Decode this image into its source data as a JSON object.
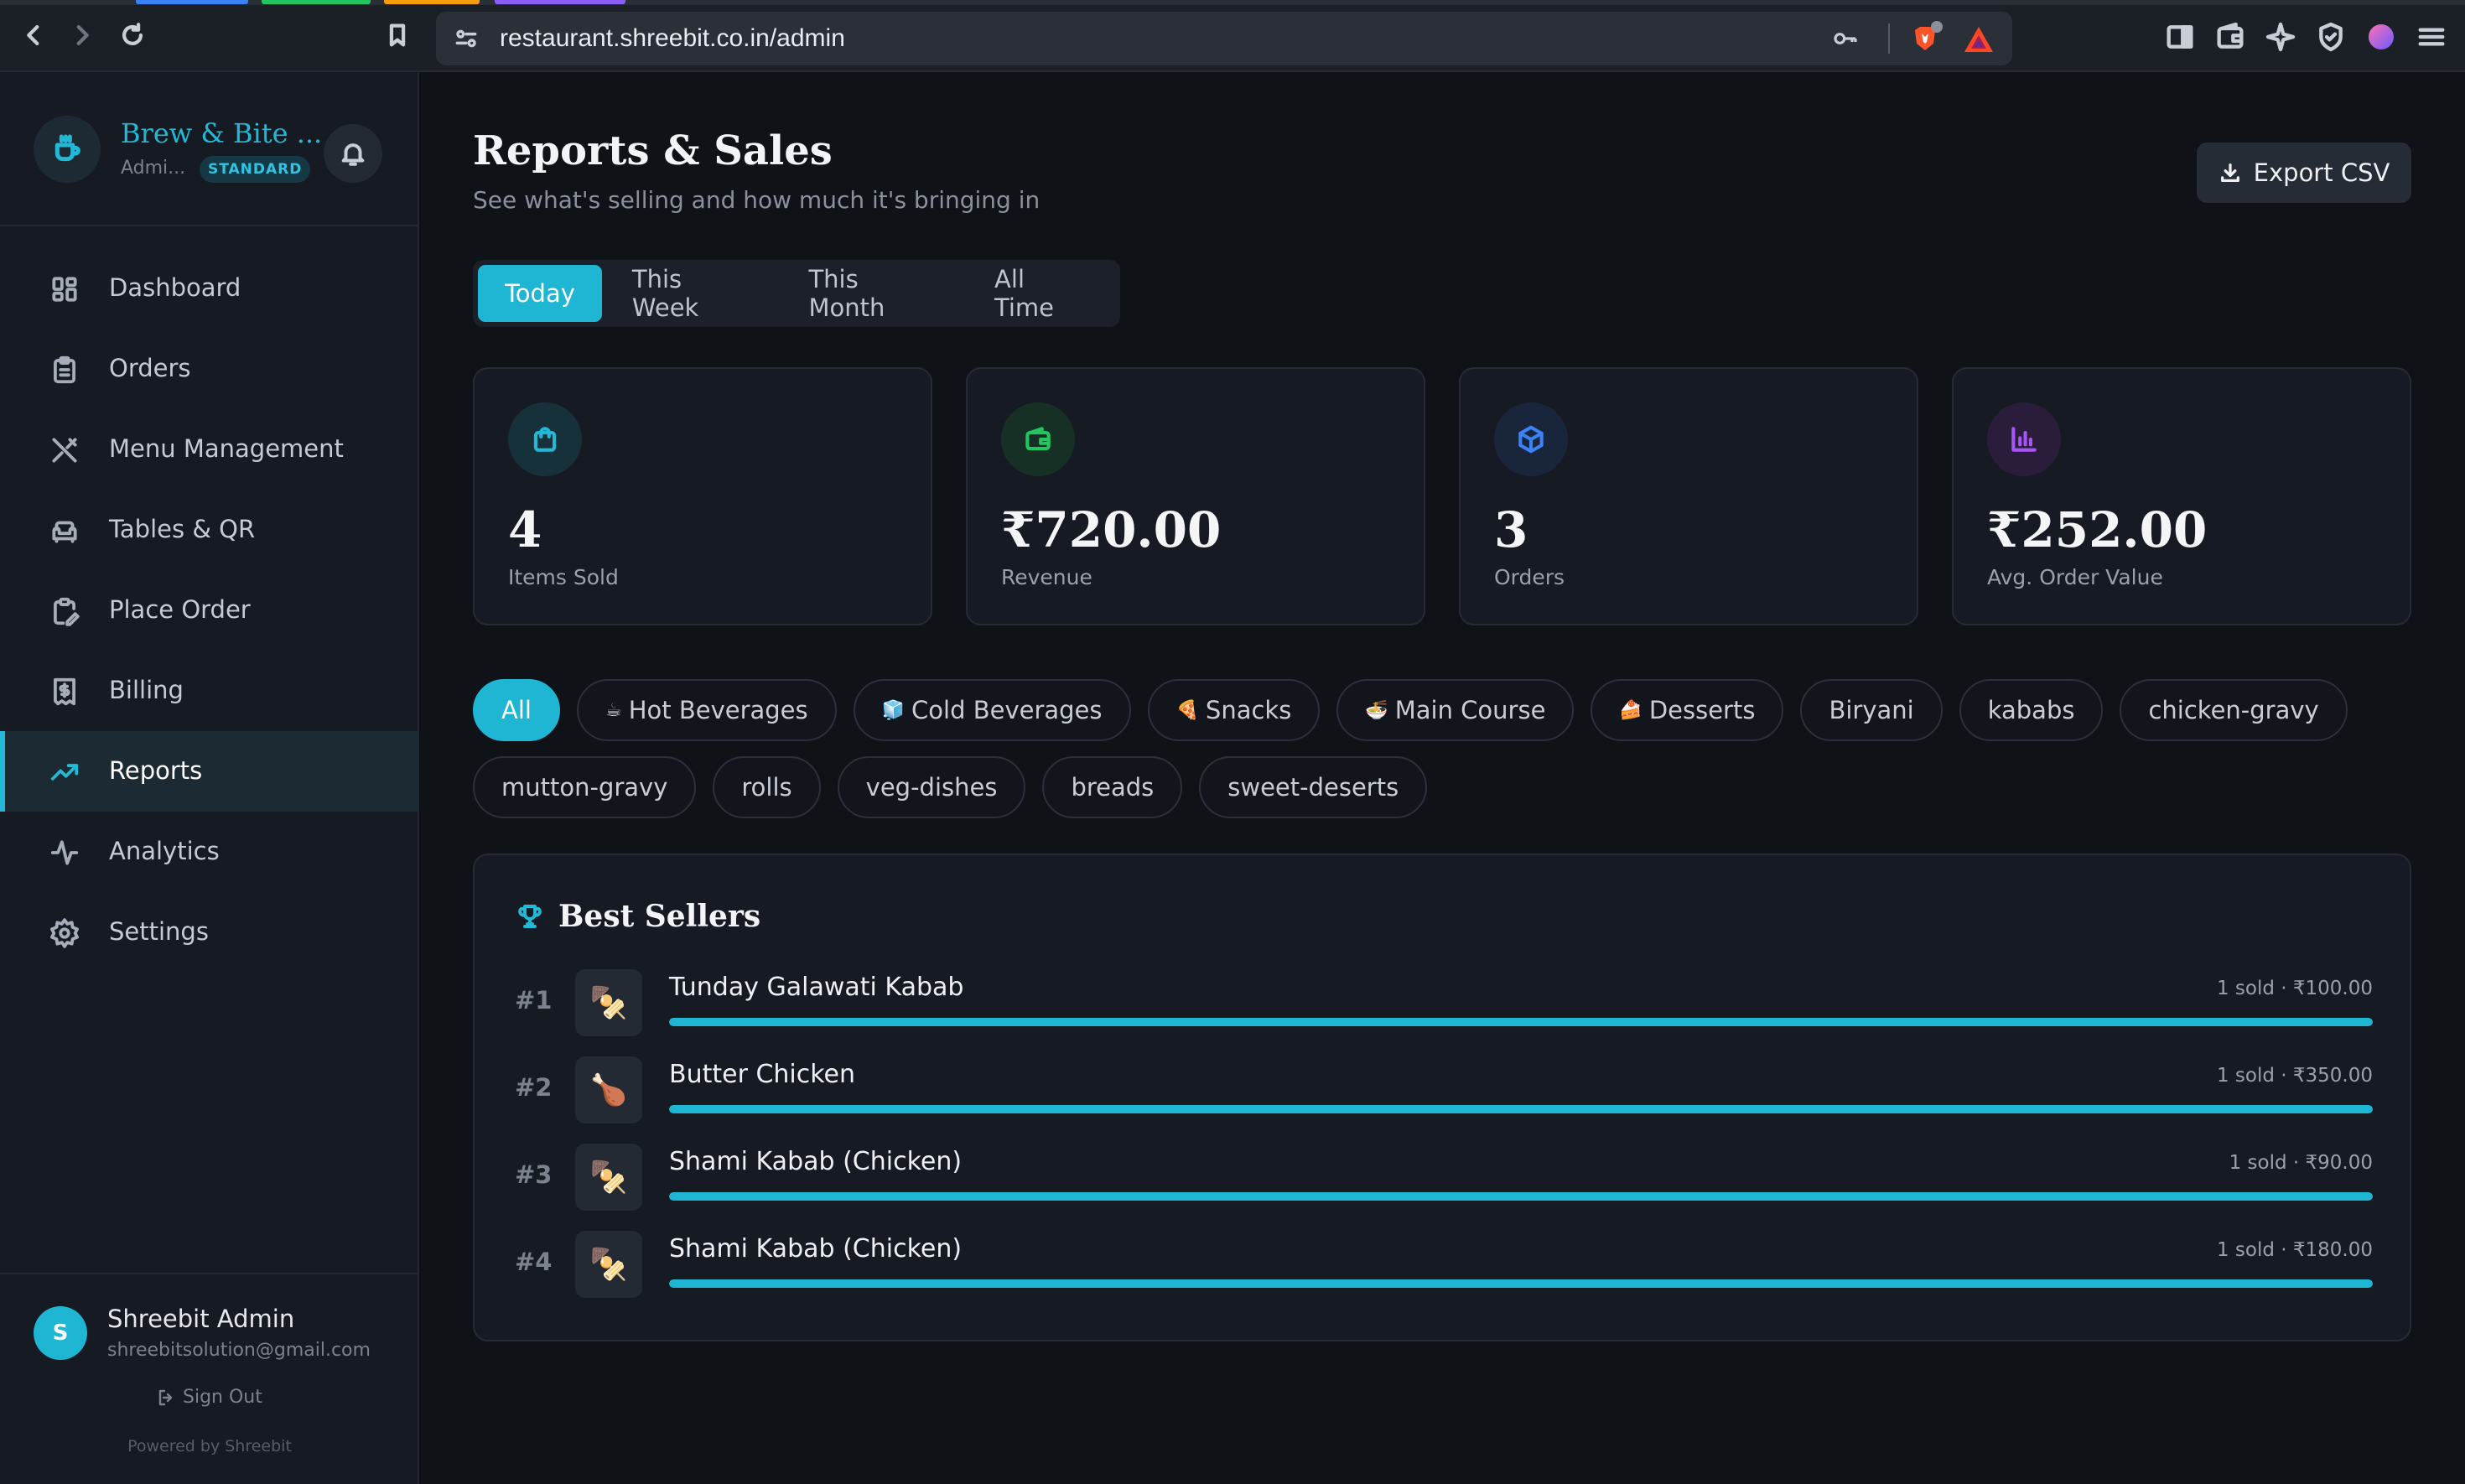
{
  "browser": {
    "url": "restaurant.shreebit.co.in/admin",
    "brave_badge": "1"
  },
  "sidebar": {
    "brand_name": "Brew & Bite ...",
    "role": "Admi...",
    "plan": "STANDARD",
    "items": [
      {
        "label": "Dashboard",
        "icon": "grid-icon"
      },
      {
        "label": "Orders",
        "icon": "clipboard-icon"
      },
      {
        "label": "Menu Management",
        "icon": "utensils-icon"
      },
      {
        "label": "Tables & QR",
        "icon": "sofa-icon"
      },
      {
        "label": "Place Order",
        "icon": "clipboard-pen-icon"
      },
      {
        "label": "Billing",
        "icon": "receipt-icon"
      },
      {
        "label": "Reports",
        "icon": "trending-up-icon",
        "active": true
      },
      {
        "label": "Analytics",
        "icon": "activity-icon"
      },
      {
        "label": "Settings",
        "icon": "gear-icon"
      }
    ],
    "user": {
      "initial": "S",
      "name": "Shreebit Admin",
      "email": "shreebitsolution@gmail.com",
      "sign_out": "Sign Out",
      "powered": "Powered by Shreebit"
    }
  },
  "main": {
    "title": "Reports & Sales",
    "subtitle": "See what's selling and how much it's bringing in",
    "export_label": "Export CSV",
    "periods": [
      "Today",
      "This Week",
      "This Month",
      "All Time"
    ],
    "active_period": "Today",
    "stats": [
      {
        "value": "4",
        "label": "Items Sold",
        "icon": "shopping-bag-icon",
        "color": "#22b8d6"
      },
      {
        "value": "₹720.00",
        "label": "Revenue",
        "icon": "wallet-icon",
        "color": "#22c55e"
      },
      {
        "value": "3",
        "label": "Orders",
        "icon": "package-icon",
        "color": "#3b82f6"
      },
      {
        "value": "₹252.00",
        "label": "Avg. Order Value",
        "icon": "bar-chart-icon",
        "color": "#a855f7"
      }
    ],
    "categories_row1": [
      {
        "label": "All",
        "emoji": "",
        "active": true
      },
      {
        "label": "Hot Beverages",
        "emoji": "☕"
      },
      {
        "label": "Cold Beverages",
        "emoji": "🧊"
      },
      {
        "label": "Snacks",
        "emoji": "🍕"
      },
      {
        "label": "Main Course",
        "emoji": "🍜"
      },
      {
        "label": "Desserts",
        "emoji": "🍰"
      },
      {
        "label": "Biryani",
        "emoji": ""
      },
      {
        "label": "kababs",
        "emoji": ""
      },
      {
        "label": "chicken-gravy",
        "emoji": ""
      }
    ],
    "categories_row2": [
      {
        "label": "mutton-gravy",
        "emoji": ""
      },
      {
        "label": "rolls",
        "emoji": ""
      },
      {
        "label": "veg-dishes",
        "emoji": ""
      },
      {
        "label": "breads",
        "emoji": ""
      },
      {
        "label": "sweet-deserts",
        "emoji": ""
      }
    ],
    "best_sellers": {
      "title": "Best Sellers",
      "items": [
        {
          "rank": "#1",
          "emoji": "🍢",
          "name": "Tunday Galawati Kabab",
          "meta": "1 sold · ₹100.00",
          "progress": 1.0
        },
        {
          "rank": "#2",
          "emoji": "🍗",
          "name": "Butter Chicken",
          "meta": "1 sold · ₹350.00",
          "progress": 1.0
        },
        {
          "rank": "#3",
          "emoji": "🍢",
          "name": "Shami Kabab (Chicken)",
          "meta": "1 sold · ₹90.00",
          "progress": 1.0
        },
        {
          "rank": "#4",
          "emoji": "🍢",
          "name": "Shami Kabab (Chicken)",
          "meta": "1 sold · ₹180.00",
          "progress": 1.0
        }
      ]
    }
  }
}
